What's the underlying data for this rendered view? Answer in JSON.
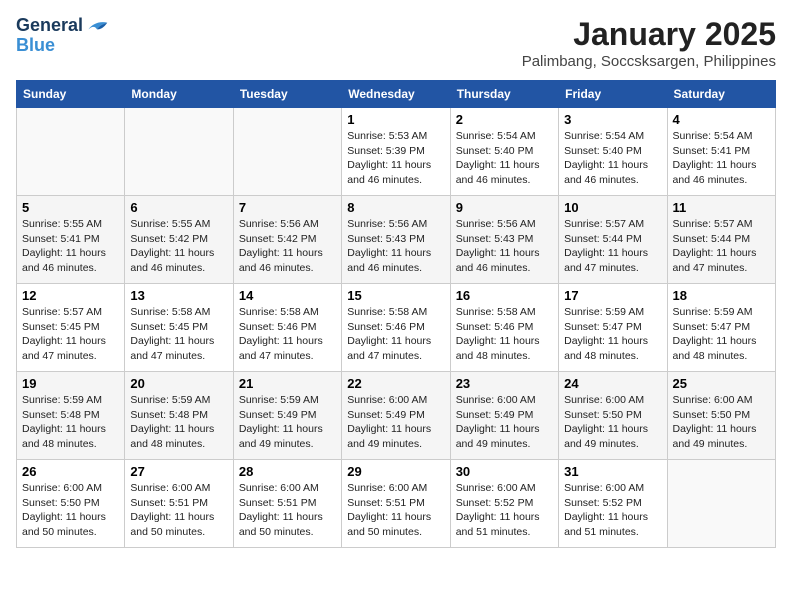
{
  "logo": {
    "line1": "General",
    "line2": "Blue"
  },
  "title": "January 2025",
  "location": "Palimbang, Soccsksargen, Philippines",
  "weekdays": [
    "Sunday",
    "Monday",
    "Tuesday",
    "Wednesday",
    "Thursday",
    "Friday",
    "Saturday"
  ],
  "weeks": [
    [
      {
        "day": "",
        "info": ""
      },
      {
        "day": "",
        "info": ""
      },
      {
        "day": "",
        "info": ""
      },
      {
        "day": "1",
        "info": "Sunrise: 5:53 AM\nSunset: 5:39 PM\nDaylight: 11 hours\nand 46 minutes."
      },
      {
        "day": "2",
        "info": "Sunrise: 5:54 AM\nSunset: 5:40 PM\nDaylight: 11 hours\nand 46 minutes."
      },
      {
        "day": "3",
        "info": "Sunrise: 5:54 AM\nSunset: 5:40 PM\nDaylight: 11 hours\nand 46 minutes."
      },
      {
        "day": "4",
        "info": "Sunrise: 5:54 AM\nSunset: 5:41 PM\nDaylight: 11 hours\nand 46 minutes."
      }
    ],
    [
      {
        "day": "5",
        "info": "Sunrise: 5:55 AM\nSunset: 5:41 PM\nDaylight: 11 hours\nand 46 minutes."
      },
      {
        "day": "6",
        "info": "Sunrise: 5:55 AM\nSunset: 5:42 PM\nDaylight: 11 hours\nand 46 minutes."
      },
      {
        "day": "7",
        "info": "Sunrise: 5:56 AM\nSunset: 5:42 PM\nDaylight: 11 hours\nand 46 minutes."
      },
      {
        "day": "8",
        "info": "Sunrise: 5:56 AM\nSunset: 5:43 PM\nDaylight: 11 hours\nand 46 minutes."
      },
      {
        "day": "9",
        "info": "Sunrise: 5:56 AM\nSunset: 5:43 PM\nDaylight: 11 hours\nand 46 minutes."
      },
      {
        "day": "10",
        "info": "Sunrise: 5:57 AM\nSunset: 5:44 PM\nDaylight: 11 hours\nand 47 minutes."
      },
      {
        "day": "11",
        "info": "Sunrise: 5:57 AM\nSunset: 5:44 PM\nDaylight: 11 hours\nand 47 minutes."
      }
    ],
    [
      {
        "day": "12",
        "info": "Sunrise: 5:57 AM\nSunset: 5:45 PM\nDaylight: 11 hours\nand 47 minutes."
      },
      {
        "day": "13",
        "info": "Sunrise: 5:58 AM\nSunset: 5:45 PM\nDaylight: 11 hours\nand 47 minutes."
      },
      {
        "day": "14",
        "info": "Sunrise: 5:58 AM\nSunset: 5:46 PM\nDaylight: 11 hours\nand 47 minutes."
      },
      {
        "day": "15",
        "info": "Sunrise: 5:58 AM\nSunset: 5:46 PM\nDaylight: 11 hours\nand 47 minutes."
      },
      {
        "day": "16",
        "info": "Sunrise: 5:58 AM\nSunset: 5:46 PM\nDaylight: 11 hours\nand 48 minutes."
      },
      {
        "day": "17",
        "info": "Sunrise: 5:59 AM\nSunset: 5:47 PM\nDaylight: 11 hours\nand 48 minutes."
      },
      {
        "day": "18",
        "info": "Sunrise: 5:59 AM\nSunset: 5:47 PM\nDaylight: 11 hours\nand 48 minutes."
      }
    ],
    [
      {
        "day": "19",
        "info": "Sunrise: 5:59 AM\nSunset: 5:48 PM\nDaylight: 11 hours\nand 48 minutes."
      },
      {
        "day": "20",
        "info": "Sunrise: 5:59 AM\nSunset: 5:48 PM\nDaylight: 11 hours\nand 48 minutes."
      },
      {
        "day": "21",
        "info": "Sunrise: 5:59 AM\nSunset: 5:49 PM\nDaylight: 11 hours\nand 49 minutes."
      },
      {
        "day": "22",
        "info": "Sunrise: 6:00 AM\nSunset: 5:49 PM\nDaylight: 11 hours\nand 49 minutes."
      },
      {
        "day": "23",
        "info": "Sunrise: 6:00 AM\nSunset: 5:49 PM\nDaylight: 11 hours\nand 49 minutes."
      },
      {
        "day": "24",
        "info": "Sunrise: 6:00 AM\nSunset: 5:50 PM\nDaylight: 11 hours\nand 49 minutes."
      },
      {
        "day": "25",
        "info": "Sunrise: 6:00 AM\nSunset: 5:50 PM\nDaylight: 11 hours\nand 49 minutes."
      }
    ],
    [
      {
        "day": "26",
        "info": "Sunrise: 6:00 AM\nSunset: 5:50 PM\nDaylight: 11 hours\nand 50 minutes."
      },
      {
        "day": "27",
        "info": "Sunrise: 6:00 AM\nSunset: 5:51 PM\nDaylight: 11 hours\nand 50 minutes."
      },
      {
        "day": "28",
        "info": "Sunrise: 6:00 AM\nSunset: 5:51 PM\nDaylight: 11 hours\nand 50 minutes."
      },
      {
        "day": "29",
        "info": "Sunrise: 6:00 AM\nSunset: 5:51 PM\nDaylight: 11 hours\nand 50 minutes."
      },
      {
        "day": "30",
        "info": "Sunrise: 6:00 AM\nSunset: 5:52 PM\nDaylight: 11 hours\nand 51 minutes."
      },
      {
        "day": "31",
        "info": "Sunrise: 6:00 AM\nSunset: 5:52 PM\nDaylight: 11 hours\nand 51 minutes."
      },
      {
        "day": "",
        "info": ""
      }
    ]
  ]
}
